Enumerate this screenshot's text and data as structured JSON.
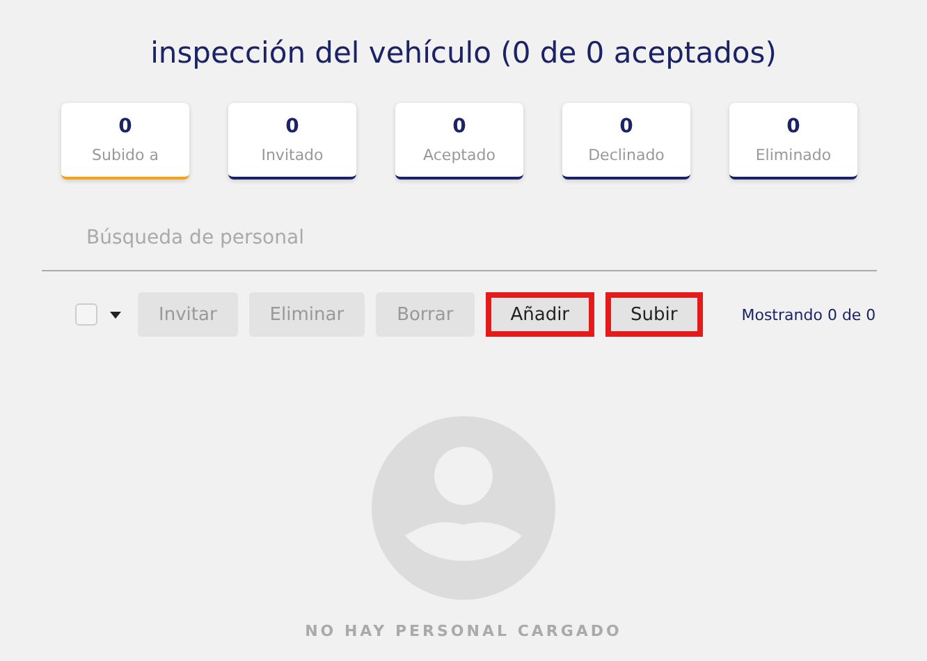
{
  "title": "inspección del vehículo (0 de 0 aceptados)",
  "tabs": [
    {
      "count": "0",
      "label": "Subido a",
      "selected": true
    },
    {
      "count": "0",
      "label": "Invitado",
      "selected": false
    },
    {
      "count": "0",
      "label": "Aceptado",
      "selected": false
    },
    {
      "count": "0",
      "label": "Declinado",
      "selected": false
    },
    {
      "count": "0",
      "label": "Eliminado",
      "selected": false
    }
  ],
  "search": {
    "placeholder": "Búsqueda de personal"
  },
  "toolbar": {
    "select_all": {
      "checked": false
    },
    "buttons": [
      {
        "label": "Invitar",
        "disabled": true,
        "highlighted": false
      },
      {
        "label": "Eliminar",
        "disabled": true,
        "highlighted": false
      },
      {
        "label": "Borrar",
        "disabled": true,
        "highlighted": false
      },
      {
        "label": "Añadir",
        "disabled": false,
        "highlighted": true
      },
      {
        "label": "Subir",
        "disabled": false,
        "highlighted": true
      }
    ],
    "showing": "Mostrando 0 de 0"
  },
  "empty_state": {
    "message": "NO HAY PERSONAL CARGADO"
  }
}
